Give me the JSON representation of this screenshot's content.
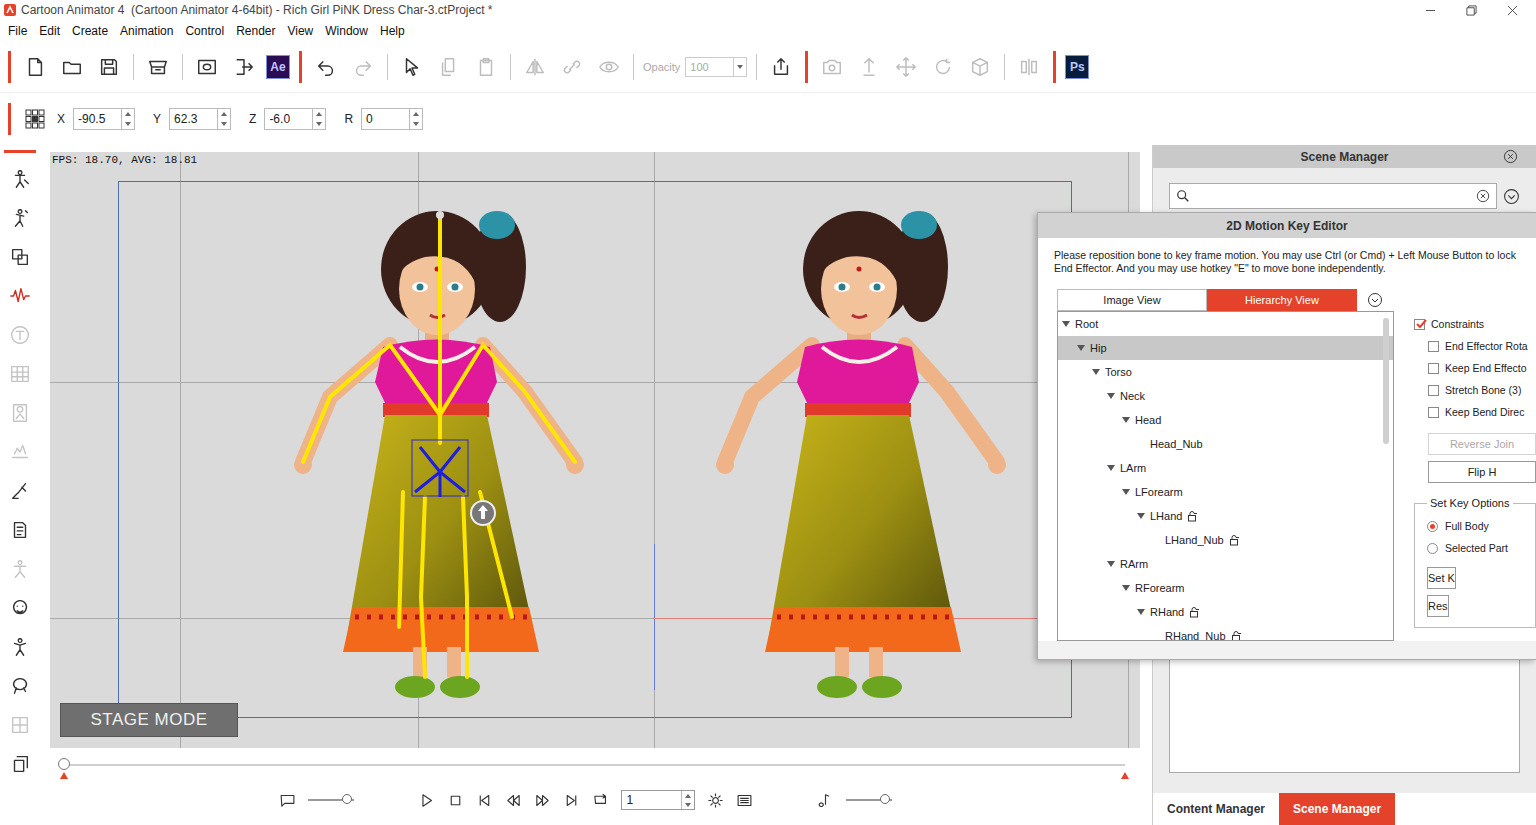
{
  "window": {
    "title": "Cartoon Animator 4  (Cartoon Animator 4-64bit) - Rich Girl PiNK Dress Char-3.ctProject *"
  },
  "menu": [
    "File",
    "Edit",
    "Create",
    "Animation",
    "Control",
    "Render",
    "View",
    "Window",
    "Help"
  ],
  "toolbar": {
    "items": [
      {
        "kind": "sep",
        "color": "#e5422b"
      },
      {
        "kind": "icon",
        "disabled": false
      },
      {
        "kind": "icon",
        "disabled": false
      },
      {
        "kind": "icon",
        "disabled": false
      },
      {
        "kind": "sep",
        "color": "#c8c8c8"
      },
      {
        "kind": "icon",
        "disabled": false
      },
      {
        "kind": "sep",
        "color": "#c8c8c8"
      },
      {
        "kind": "icon",
        "disabled": false
      },
      {
        "kind": "icon",
        "disabled": false
      },
      {
        "kind": "logo",
        "text": "Ae",
        "color": "#2a0c55",
        "disabled": false
      },
      {
        "kind": "sep",
        "color": "#e5422b"
      },
      {
        "kind": "icon",
        "disabled": false
      },
      {
        "kind": "icon",
        "disabled": true
      },
      {
        "kind": "sep",
        "color": "#c8c8c8"
      },
      {
        "kind": "icon",
        "disabled": false
      },
      {
        "kind": "icon",
        "disabled": true
      },
      {
        "kind": "icon",
        "disabled": true
      },
      {
        "kind": "sep",
        "color": "#c8c8c8"
      },
      {
        "kind": "icon",
        "disabled": true
      },
      {
        "kind": "icon",
        "disabled": true
      },
      {
        "kind": "icon",
        "disabled": true
      },
      {
        "kind": "sep",
        "color": "#c8c8c8"
      },
      {
        "kind": "field",
        "label": "Opacity",
        "value": "100",
        "disabled": true
      },
      {
        "kind": "sep",
        "color": "#c8c8c8"
      },
      {
        "kind": "icon",
        "disabled": false
      },
      {
        "kind": "sep",
        "color": "#e5422b"
      },
      {
        "kind": "icon",
        "disabled": true
      },
      {
        "kind": "icon",
        "disabled": true
      },
      {
        "kind": "icon",
        "disabled": true
      },
      {
        "kind": "icon",
        "disabled": true
      },
      {
        "kind": "icon",
        "disabled": true
      },
      {
        "kind": "sep",
        "color": "#c8c8c8"
      },
      {
        "kind": "icon",
        "disabled": true
      },
      {
        "kind": "sep",
        "color": "#e5422b"
      },
      {
        "kind": "logo",
        "text": "Ps",
        "color": "#061e3c",
        "disabled": false
      }
    ]
  },
  "transform": [
    {
      "label": "X",
      "value": "-90.5"
    },
    {
      "label": "Y",
      "value": "62.3"
    },
    {
      "label": "Z",
      "value": "-6.0"
    },
    {
      "label": "R",
      "value": "0"
    }
  ],
  "tool_strip": [
    {
      "disabled": false
    },
    {
      "disabled": false
    },
    {
      "disabled": false
    },
    {
      "disabled": false
    },
    {
      "disabled": true
    },
    {
      "disabled": true
    },
    {
      "disabled": true
    },
    {
      "disabled": true
    },
    {
      "disabled": false
    },
    {
      "disabled": false
    },
    {
      "disabled": true
    },
    {
      "disabled": false
    },
    {
      "disabled": false
    },
    {
      "disabled": false
    },
    {
      "disabled": true
    },
    {
      "disabled": false
    }
  ],
  "viewport": {
    "fps_text": "FPS: 18.70, AVG: 18.81",
    "mode_badge": "STAGE MODE",
    "characters": [
      {
        "selected": true
      },
      {
        "selected": false
      }
    ]
  },
  "timeline": {
    "scrubber": {
      "level": 0
    },
    "caption_slider": {
      "level": 0.85
    },
    "volume_slider": {
      "level": 0.85
    },
    "frame": "1"
  },
  "scene_manager": {
    "title": "Scene Manager"
  },
  "bottom_tabs": [
    {
      "label": "Content Manager",
      "selected": false
    },
    {
      "label": "Scene Manager",
      "selected": true
    }
  ],
  "motion_key_editor": {
    "title": "2D Motion Key Editor",
    "instructions": "Please reposition bone to key frame motion. You may use Ctrl (or Cmd) + Left Mouse Button to lock End Effector. And you may use hotkey \"E\" to move bone independently.",
    "tabs": [
      {
        "label": "Image View",
        "selected": false
      },
      {
        "label": "Hierarchy View",
        "selected": true
      }
    ],
    "tree": [
      {
        "label": "Root",
        "depth": 0,
        "expanded": true,
        "selected": false,
        "locked": false
      },
      {
        "label": "Hip",
        "depth": 1,
        "expanded": true,
        "selected": true,
        "locked": false
      },
      {
        "label": "Torso",
        "depth": 2,
        "expanded": true,
        "selected": false,
        "locked": false
      },
      {
        "label": "Neck",
        "depth": 3,
        "expanded": true,
        "selected": false,
        "locked": false
      },
      {
        "label": "Head",
        "depth": 4,
        "expanded": true,
        "selected": false,
        "locked": false
      },
      {
        "label": "Head_Nub",
        "depth": 5,
        "expanded": false,
        "selected": false,
        "locked": false
      },
      {
        "label": "LArm",
        "depth": 3,
        "expanded": true,
        "selected": false,
        "locked": false
      },
      {
        "label": "LForearm",
        "depth": 4,
        "expanded": true,
        "selected": false,
        "locked": false
      },
      {
        "label": "LHand",
        "depth": 5,
        "expanded": true,
        "selected": false,
        "locked": true
      },
      {
        "label": "LHand_Nub",
        "depth": 6,
        "expanded": false,
        "selected": false,
        "locked": true
      },
      {
        "label": "RArm",
        "depth": 3,
        "expanded": true,
        "selected": false,
        "locked": false
      },
      {
        "label": "RForearm",
        "depth": 4,
        "expanded": true,
        "selected": false,
        "locked": false
      },
      {
        "label": "RHand",
        "depth": 5,
        "expanded": true,
        "selected": false,
        "locked": true
      },
      {
        "label": "RHand_Nub",
        "depth": 6,
        "expanded": false,
        "selected": false,
        "locked": true
      }
    ],
    "constraints": {
      "label": "Constraints",
      "checked": true
    },
    "options": [
      {
        "label": "End Effector Rota",
        "checked": false
      },
      {
        "label": "Keep End Effecto",
        "checked": false
      },
      {
        "label": "Stretch Bone (3)",
        "checked": false
      },
      {
        "label": "Keep Bend Direc",
        "checked": false
      }
    ],
    "buttons": [
      {
        "label": "Reverse Join",
        "disabled": true
      },
      {
        "label": "Flip H",
        "disabled": false
      }
    ],
    "set_key_options": {
      "title": "Set Key Options",
      "choices": [
        {
          "label": "Full Body",
          "selected": true
        },
        {
          "label": "Selected Part",
          "selected": false
        }
      ]
    },
    "action_buttons": [
      {
        "label": "Set K",
        "disabled": false
      },
      {
        "label": "Res",
        "disabled": false
      }
    ]
  }
}
